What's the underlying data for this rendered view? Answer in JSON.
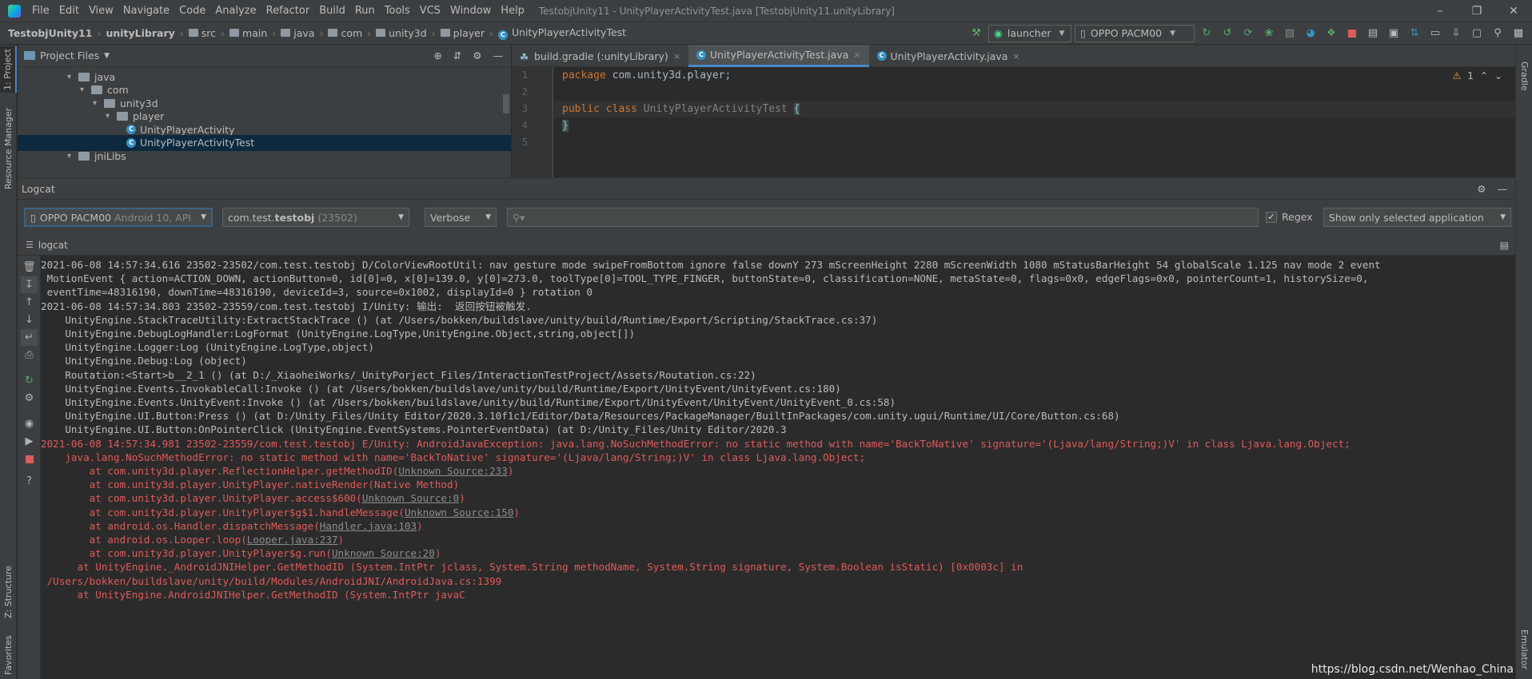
{
  "menubar": {
    "items": [
      "File",
      "Edit",
      "View",
      "Navigate",
      "Code",
      "Analyze",
      "Refactor",
      "Build",
      "Run",
      "Tools",
      "VCS",
      "Window",
      "Help"
    ],
    "window_title": "TestobjUnity11 - UnityPlayerActivityTest.java [TestobjUnity11.unityLibrary]"
  },
  "navbar": {
    "crumbs": [
      "TestobjUnity11",
      "unityLibrary",
      "src",
      "main",
      "java",
      "com",
      "unity3d",
      "player",
      "UnityPlayerActivityTest"
    ],
    "run_config": "launcher",
    "device": "OPPO PACM00"
  },
  "left_strip": {
    "project_tab": "1: Project",
    "resource_tab": "Resource Manager",
    "structure_tab": "Z: Structure",
    "favorites_tab": "Favorites"
  },
  "right_strip": {
    "gradle_tab": "Gradle",
    "emulator_tab": "Emulator"
  },
  "project": {
    "header": "Project Files",
    "tree": [
      {
        "label": "java",
        "indent": 0,
        "expanded": true,
        "kind": "folder"
      },
      {
        "label": "com",
        "indent": 1,
        "expanded": true,
        "kind": "folder"
      },
      {
        "label": "unity3d",
        "indent": 2,
        "expanded": true,
        "kind": "folder"
      },
      {
        "label": "player",
        "indent": 3,
        "expanded": true,
        "kind": "folder"
      },
      {
        "label": "UnityPlayerActivity",
        "indent": 4,
        "kind": "class"
      },
      {
        "label": "UnityPlayerActivityTest",
        "indent": 4,
        "kind": "class",
        "selected": true
      },
      {
        "label": "jniLibs",
        "indent": 0,
        "expanded": true,
        "kind": "folder"
      }
    ]
  },
  "editor": {
    "tabs": [
      {
        "label": "build.gradle (:unityLibrary)",
        "kind": "gradle"
      },
      {
        "label": "UnityPlayerActivityTest.java",
        "kind": "class",
        "active": true
      },
      {
        "label": "UnityPlayerActivity.java",
        "kind": "class"
      }
    ],
    "warning_count": "1",
    "line_numbers": [
      "1",
      "2",
      "3",
      "4",
      "5"
    ],
    "code": {
      "l1_kw": "package",
      "l1_rest": " com.unity3d.player;",
      "l3_kw1": "public",
      "l3_kw2": "class",
      "l3_name": "UnityPlayerActivityTest",
      "l3_brace": "{",
      "l4_brace": "}"
    }
  },
  "logcat": {
    "title": "Logcat",
    "device": "OPPO PACM00",
    "device_detail": "Android 10, API",
    "process_prefix": "com.test.",
    "process_bold": "testobj",
    "process_pid": "(23502)",
    "level": "Verbose",
    "search_placeholder": "",
    "regex_label": "Regex",
    "filter": "Show only selected application",
    "sub_tab": "logcat",
    "lines": [
      {
        "t": "2021-06-08 14:57:34.616 23502-23502/com.test.testobj D/ColorViewRootUtil: nav gesture mode swipeFromBottom ignore false downY 273 mScreenHeight 2280 mScreenWidth 1080 mStatusBarHeight 54 globalScale 1.125 nav mode 2 event",
        "err": false
      },
      {
        "t": " MotionEvent { action=ACTION_DOWN, actionButton=0, id[0]=0, x[0]=139.0, y[0]=273.0, toolType[0]=TOOL_TYPE_FINGER, buttonState=0, classification=NONE, metaState=0, flags=0x0, edgeFlags=0x0, pointerCount=1, historySize=0,",
        "err": false
      },
      {
        "t": " eventTime=48316190, downTime=48316190, deviceId=3, source=0x1002, displayId=0 } rotation 0",
        "err": false
      },
      {
        "t": "2021-06-08 14:57:34.803 23502-23559/com.test.testobj I/Unity: 输出:  返回按钮被触发.",
        "err": false
      },
      {
        "t": "    UnityEngine.StackTraceUtility:ExtractStackTrace () (at /Users/bokken/buildslave/unity/build/Runtime/Export/Scripting/StackTrace.cs:37)",
        "err": false
      },
      {
        "t": "    UnityEngine.DebugLogHandler:LogFormat (UnityEngine.LogType,UnityEngine.Object,string,object[])",
        "err": false
      },
      {
        "t": "    UnityEngine.Logger:Log (UnityEngine.LogType,object)",
        "err": false
      },
      {
        "t": "    UnityEngine.Debug:Log (object)",
        "err": false
      },
      {
        "t": "    Routation:<Start>b__2_1 () (at D:/_XiaoheiWorks/_UnityPorject_Files/InteractionTestProject/Assets/Routation.cs:22)",
        "err": false
      },
      {
        "t": "    UnityEngine.Events.InvokableCall:Invoke () (at /Users/bokken/buildslave/unity/build/Runtime/Export/UnityEvent/UnityEvent.cs:180)",
        "err": false
      },
      {
        "t": "    UnityEngine.Events.UnityEvent:Invoke () (at /Users/bokken/buildslave/unity/build/Runtime/Export/UnityEvent/UnityEvent/UnityEvent_0.cs:58)",
        "err": false
      },
      {
        "t": "    UnityEngine.UI.Button:Press () (at D:/Unity_Files/Unity Editor/2020.3.10f1c1/Editor/Data/Resources/PackageManager/BuiltInPackages/com.unity.ugui/Runtime/UI/Core/Button.cs:68)",
        "err": false
      },
      {
        "t": "    UnityEngine.UI.Button:OnPointerClick (UnityEngine.EventSystems.PointerEventData) (at D:/Unity_Files/Unity Editor/2020.3",
        "err": false
      },
      {
        "t": "2021-06-08 14:57:34.981 23502-23559/com.test.testobj E/Unity: AndroidJavaException: java.lang.NoSuchMethodError: no static method with name='BackToNative' signature='(Ljava/lang/String;)V' in class Ljava.lang.Object;",
        "err": true
      },
      {
        "t": "    java.lang.NoSuchMethodError: no static method with name='BackToNative' signature='(Ljava/lang/String;)V' in class Ljava.lang.Object;",
        "err": true
      },
      {
        "t": "        at com.unity3d.player.ReflectionHelper.getMethodID(",
        "link": "Unknown Source:233",
        "tail": ")",
        "err": true
      },
      {
        "t": "        at com.unity3d.player.UnityPlayer.nativeRender(Native Method)",
        "err": true
      },
      {
        "t": "        at com.unity3d.player.UnityPlayer.access$600(",
        "link": "Unknown Source:0",
        "tail": ")",
        "err": true
      },
      {
        "t": "        at com.unity3d.player.UnityPlayer$g$1.handleMessage(",
        "link": "Unknown Source:150",
        "tail": ")",
        "err": true
      },
      {
        "t": "        at android.os.Handler.dispatchMessage(",
        "link": "Handler.java:103",
        "tail": ")",
        "err": true
      },
      {
        "t": "        at android.os.Looper.loop(",
        "link": "Looper.java:237",
        "tail": ")",
        "err": true
      },
      {
        "t": "        at com.unity3d.player.UnityPlayer$g.run(",
        "link": "Unknown Source:20",
        "tail": ")",
        "err": true
      },
      {
        "t": "      at UnityEngine._AndroidJNIHelper.GetMethodID (System.IntPtr jclass, System.String methodName, System.String signature, System.Boolean isStatic) [0x0003c] in",
        "err": true
      },
      {
        "t": " /Users/bokken/buildslave/unity/build/Modules/AndroidJNI/AndroidJava.cs:1399",
        "err": true
      },
      {
        "t": "      at UnityEngine.AndroidJNIHelper.GetMethodID (System.IntPtr javaC",
        "err": true
      }
    ]
  },
  "watermark": "https://blog.csdn.net/Wenhao_China",
  "colors": {
    "error": "#e05a5a",
    "keyword": "#cc7832",
    "selection": "#0d293e",
    "accent": "#4a88c7"
  }
}
